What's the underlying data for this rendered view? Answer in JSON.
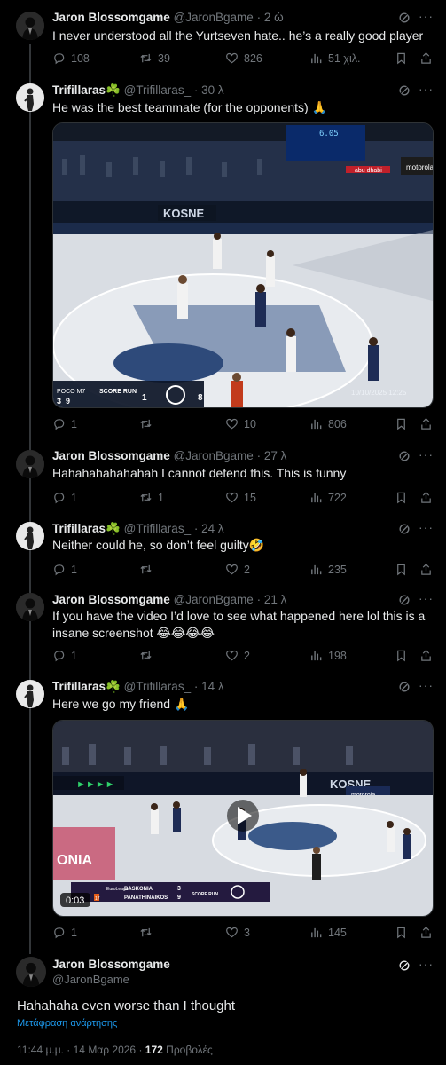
{
  "tweets": [
    {
      "name": "Jaron Blossomgame",
      "handle": "@JaronBgame",
      "time": "· 2 ώ",
      "text": "I never understood all the Yurtseven hate.. he’s a really good player",
      "replies": "108",
      "retweets": "39",
      "likes": "826",
      "views": "51 χιλ."
    },
    {
      "name": "Trifillaras☘️",
      "handle": "@Trifillaras_",
      "time": "· 30 λ",
      "text": "He was the best teammate (for the opponents) 🙏",
      "media": {
        "scoreboard_left": "POCO M7",
        "score_home": "3",
        "score_away": "9",
        "score_label": "SCORE RUN",
        "run_home": "1",
        "run_away": "8",
        "timestamp": "10/10/2025 12:25",
        "shot_clock": "6.05",
        "court_brand": "KOSNE",
        "sponsor": "motorola",
        "sponsor2": "abu dhabi"
      },
      "replies": "1",
      "retweets": "",
      "likes": "10",
      "views": "806"
    },
    {
      "name": "Jaron Blossomgame",
      "handle": "@JaronBgame",
      "time": "· 27 λ",
      "text": "Hahahahahahahah I cannot defend this. This is funny",
      "replies": "1",
      "retweets": "1",
      "likes": "15",
      "views": "722"
    },
    {
      "name": "Trifillaras☘️",
      "handle": "@Trifillaras_",
      "time": "· 24 λ",
      "text": "Neither could he, so don’t feel guilty🤣",
      "replies": "1",
      "retweets": "",
      "likes": "2",
      "views": "235"
    },
    {
      "name": "Jaron Blossomgame",
      "handle": "@JaronBgame",
      "time": "· 21 λ",
      "text": "If you have the video I’d love to see what happened here lol this is a insane screenshot 😂😂😂😂",
      "replies": "1",
      "retweets": "",
      "likes": "2",
      "views": "198"
    },
    {
      "name": "Trifillaras☘️",
      "handle": "@Trifillaras_",
      "time": "· 14 λ",
      "text": "Here we go my friend 🙏",
      "media": {
        "duration": "0:03",
        "league": "EuroLeague",
        "team_home": "BASKONIA",
        "team_away": "PANATHINAIKOS",
        "score_home": "3",
        "score_away": "9",
        "score_label": "SCORE RUN",
        "banner": "ONIA",
        "court_brand": "KOSNE",
        "sponsor": "motorola",
        "quarter_small": "7",
        "quarter_badge": "17"
      },
      "replies": "1",
      "retweets": "",
      "likes": "3",
      "views": "145"
    }
  ],
  "main": {
    "name": "Jaron Blossomgame",
    "handle": "@JaronBgame",
    "text": "Hahahaha even worse than I thought",
    "translate": "Μετάφραση ανάρτησης",
    "time": "11:44 μ.μ. · 14 Μαρ 2026 · ",
    "views_count": "172",
    "views_label": " Προβολές"
  },
  "icons": {
    "reply": "reply-icon",
    "retweet": "retweet-icon",
    "like": "heart-icon",
    "views": "views-icon",
    "bookmark": "bookmark-icon",
    "share": "share-icon",
    "grok": "grok-icon",
    "more": "more-icon"
  },
  "colors": {
    "background": "#000000",
    "text": "#e7e9ea",
    "muted": "#71767b",
    "link": "#1d9bf0",
    "line": "#333639"
  }
}
